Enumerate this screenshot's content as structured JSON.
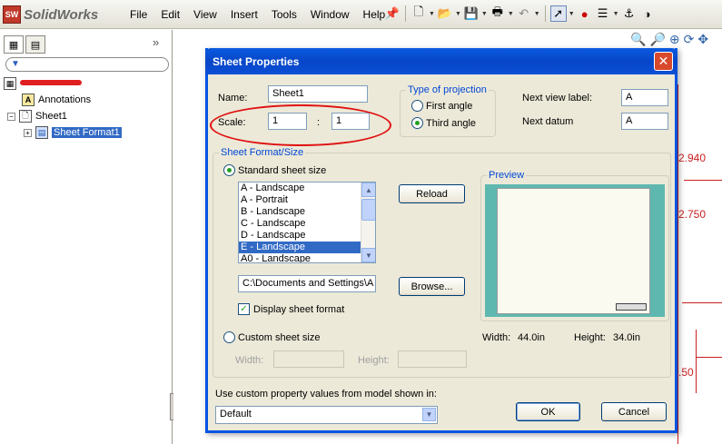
{
  "app": {
    "name": "SolidWorks",
    "logo_badge": "SW"
  },
  "menu": [
    "File",
    "Edit",
    "View",
    "Insert",
    "Tools",
    "Window",
    "Help"
  ],
  "toolbar_icons": [
    "pin-icon",
    "new-doc-icon",
    "open-folder-icon",
    "save-icon",
    "print-icon",
    "undo-icon",
    "select-pointer-icon",
    "traffic-light-icon",
    "options-icon",
    "anchor-icon",
    "sphere-icon"
  ],
  "feature_tree": {
    "annotations": "Annotations",
    "sheet": "Sheet1",
    "sheet_format": "Sheet Format1",
    "expander_minus": "−",
    "expander_plus": "+"
  },
  "drawing": {
    "dim1": "2.940",
    "dim2": "2.750",
    "dim3": ".50"
  },
  "dialog": {
    "title": "Sheet Properties",
    "close": "✕",
    "name_label": "Name:",
    "name_value": "Sheet1",
    "scale_label": "Scale:",
    "scale_num": "1",
    "scale_sep": ":",
    "scale_den": "1",
    "projection": {
      "title": "Type of projection",
      "first": "First angle",
      "third": "Third angle",
      "selected": "third"
    },
    "next_view_label": "Next view label:",
    "next_view_value": "A",
    "next_datum_label": "Next datum",
    "next_datum_value": "A",
    "format": {
      "title": "Sheet Format/Size",
      "standard": "Standard sheet size",
      "sizes": [
        "A - Landscape",
        "A - Portrait",
        "B - Landscape",
        "C - Landscape",
        "D - Landscape",
        "E - Landscape",
        "A0 - Landscape"
      ],
      "selected_size": "E - Landscape",
      "reload": "Reload",
      "path": "C:\\Documents and Settings\\A",
      "browse": "Browse...",
      "display_format": "Display sheet format",
      "display_checked": true,
      "custom": "Custom sheet size",
      "width_label": "Width:",
      "height_label": "Height:"
    },
    "preview": {
      "title": "Preview",
      "width_label": "Width:",
      "width_value": "44.0in",
      "height_label": "Height:",
      "height_value": "34.0in"
    },
    "custom_prop_label": "Use custom property values from model shown in:",
    "custom_prop_value": "Default",
    "ok": "OK",
    "cancel": "Cancel"
  }
}
